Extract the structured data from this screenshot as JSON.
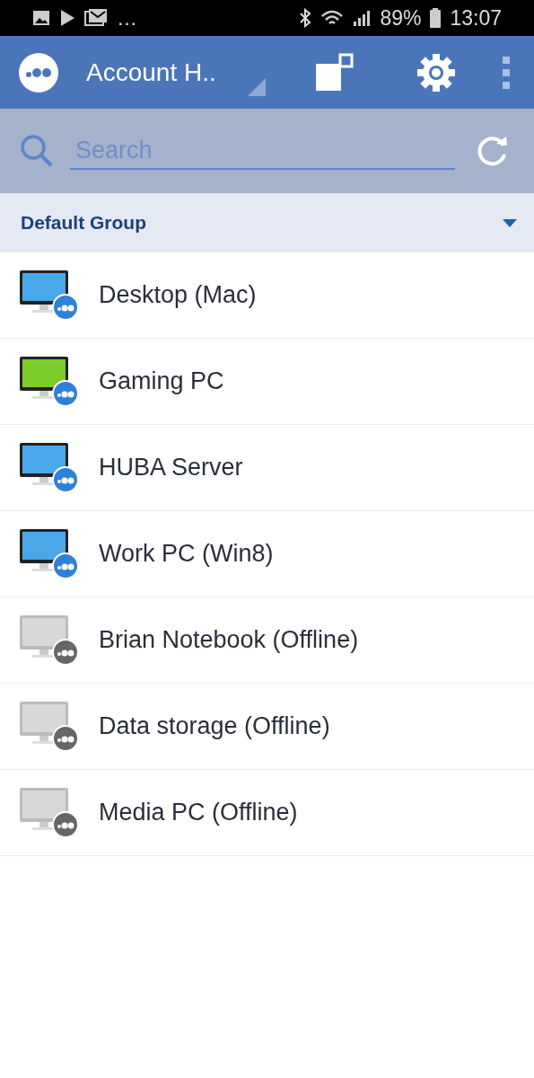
{
  "status_bar": {
    "overflow": "…",
    "battery": "89%",
    "time": "13:07"
  },
  "app_bar": {
    "title": "Account H.."
  },
  "search": {
    "placeholder": "Search"
  },
  "group": {
    "name": "Default Group",
    "expanded": true
  },
  "devices": [
    {
      "name": "Desktop (Mac)",
      "online": true,
      "color": "#4aa8e8"
    },
    {
      "name": "Gaming PC",
      "online": true,
      "color": "#7ccc2a"
    },
    {
      "name": "HUBA Server",
      "online": true,
      "color": "#4aa8e8"
    },
    {
      "name": "Work PC (Win8)",
      "online": true,
      "color": "#4aa8e8"
    },
    {
      "name": "Brian Notebook (Offline)",
      "online": false,
      "color": "#d8d8d8"
    },
    {
      "name": "Data storage (Offline)",
      "online": false,
      "color": "#d8d8d8"
    },
    {
      "name": "Media PC (Offline)",
      "online": false,
      "color": "#d8d8d8"
    }
  ]
}
